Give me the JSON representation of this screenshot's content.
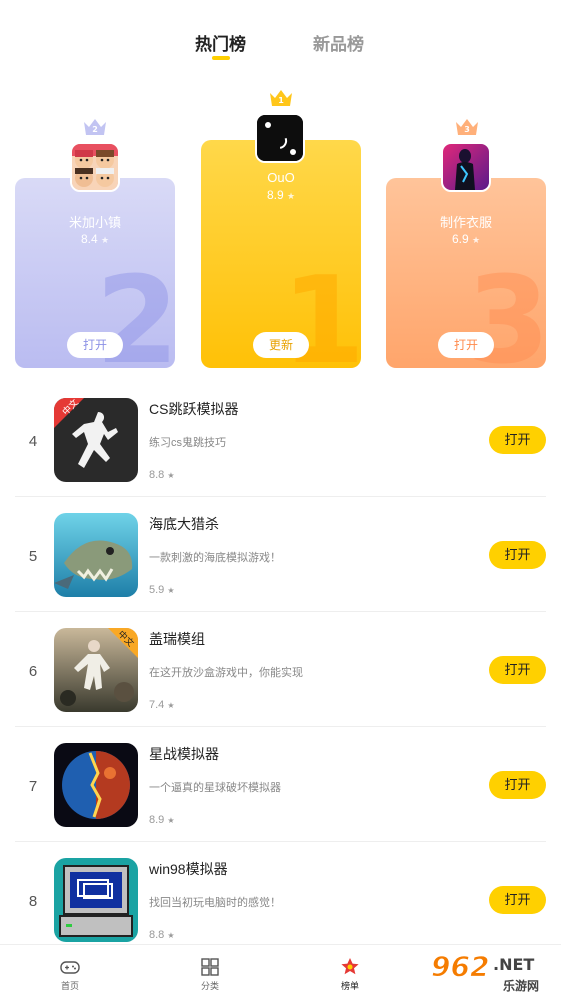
{
  "tabs": {
    "hot": "热门榜",
    "new": "新品榜"
  },
  "podium": [
    {
      "rank": "2",
      "name": "米加小镇",
      "rating": "8.4",
      "button": "打开",
      "big_number": "2"
    },
    {
      "rank": "1",
      "name": "OuO",
      "rating": "8.9",
      "button": "更新",
      "big_number": "1"
    },
    {
      "rank": "3",
      "name": "制作衣服",
      "rating": "6.9",
      "button": "打开",
      "big_number": "3"
    }
  ],
  "list": [
    {
      "rank": "4",
      "name": "CS跳跃模拟器",
      "desc": "练习cs鬼跳技巧",
      "rating": "8.8",
      "button": "打开",
      "badge": "中文"
    },
    {
      "rank": "5",
      "name": "海底大猎杀",
      "desc": "一款刺激的海底模拟游戏！",
      "rating": "5.9",
      "button": "打开"
    },
    {
      "rank": "6",
      "name": "盖瑞模组",
      "desc": "在这开放沙盒游戏中，你能实现",
      "rating": "7.4",
      "button": "打开",
      "badge": "中文"
    },
    {
      "rank": "7",
      "name": "星战模拟器",
      "desc": "一个逼真的星球破坏模拟器",
      "rating": "8.9",
      "button": "打开"
    },
    {
      "rank": "8",
      "name": "win98模拟器",
      "desc": "找回当初玩电脑时的感觉！",
      "rating": "8.8",
      "button": "打开"
    }
  ],
  "star": "★",
  "nav": {
    "home": "首页",
    "category": "分类",
    "ranking": "榜单"
  },
  "watermark": {
    "number": "962",
    "suffix": ".NET",
    "sub": "乐游网"
  },
  "colors": {
    "accent": "#FFD000",
    "rank2": "#BABCF1",
    "rank1": "#FFC107",
    "rank3": "#FFA56B"
  }
}
